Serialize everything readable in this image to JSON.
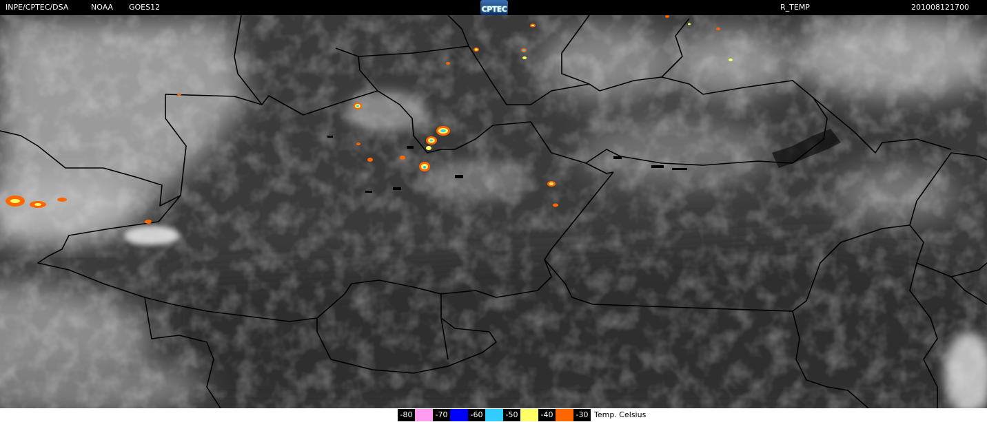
{
  "header": {
    "org": "INPE/CPTEC/DSA",
    "agency": "NOAA",
    "satellite": "GOES12",
    "logo_text": "CPTEC",
    "product": "R_TEMP",
    "timestamp": "201008121700"
  },
  "legend": {
    "items": [
      {
        "label": "-80",
        "color": "#ff9cf0"
      },
      {
        "label": "-70",
        "color": "#0000ff"
      },
      {
        "label": "-60",
        "color": "#33ccff"
      },
      {
        "label": "-50",
        "color": "#ffff66"
      },
      {
        "label": "-40",
        "color": "#ff6600"
      },
      {
        "label": "-30",
        "color": ""
      }
    ],
    "unit": "Temp. Celsius"
  },
  "colors": {
    "border_line": "#000000",
    "background": "#000000",
    "map_dark": "#383838",
    "cloud_light": "#b8b8b8"
  }
}
